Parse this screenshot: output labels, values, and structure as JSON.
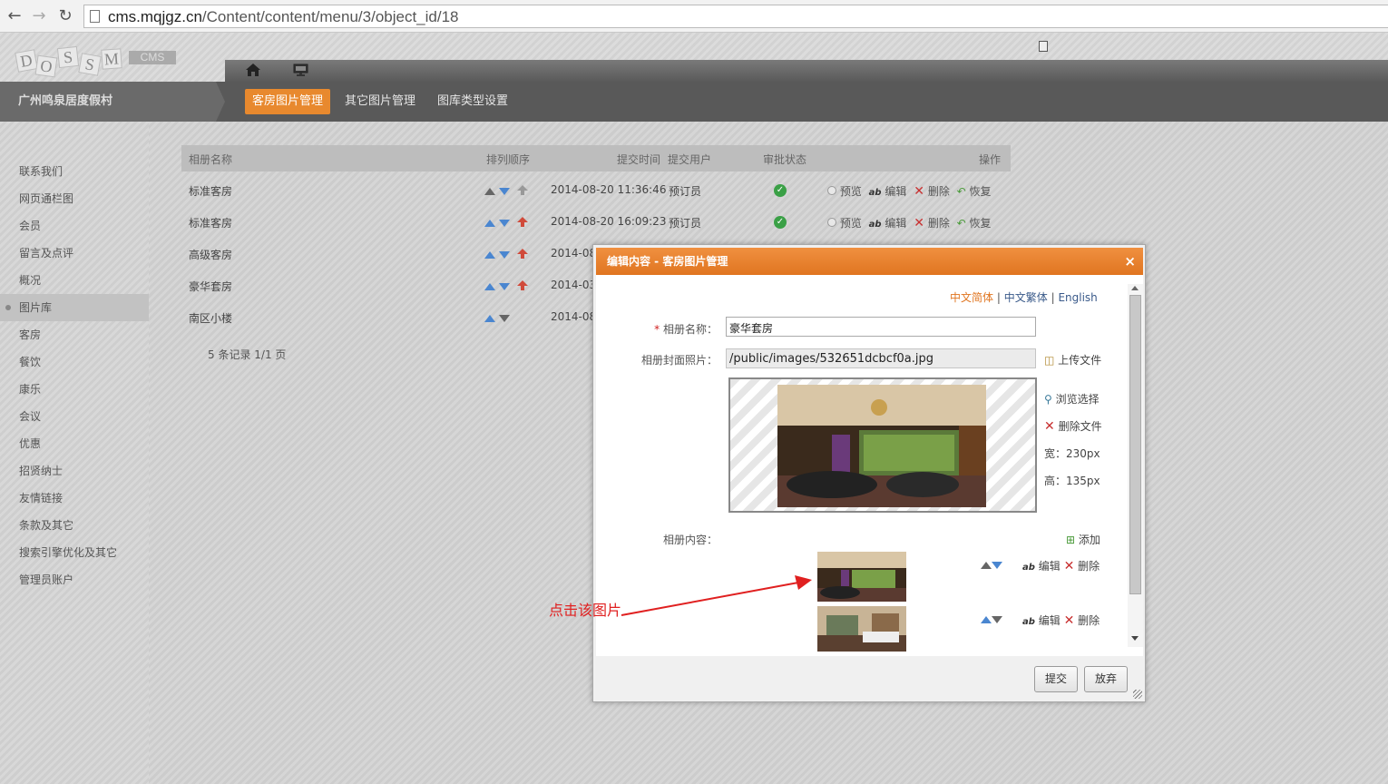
{
  "browser": {
    "url_domain": "cms.mqjgz.cn",
    "url_path": "/Content/content/menu/3/object_id/18"
  },
  "logo": {
    "letters": [
      "D",
      "O",
      "S",
      "S",
      "M"
    ],
    "badge": "CMS"
  },
  "site": {
    "name": "广州鸣泉居度假村"
  },
  "tabs": [
    {
      "label": "客房图片管理",
      "active": true
    },
    {
      "label": "其它图片管理",
      "active": false
    },
    {
      "label": "图库类型设置",
      "active": false
    }
  ],
  "sidebar": {
    "items": [
      {
        "label": "联系我们"
      },
      {
        "label": "网页通栏图"
      },
      {
        "label": "会员"
      },
      {
        "label": "留言及点评"
      },
      {
        "label": "概况"
      },
      {
        "label": "图片库",
        "active": true
      },
      {
        "label": "客房"
      },
      {
        "label": "餐饮"
      },
      {
        "label": "康乐"
      },
      {
        "label": "会议"
      },
      {
        "label": "优惠"
      },
      {
        "label": "招贤纳士"
      },
      {
        "label": "友情链接"
      },
      {
        "label": "条款及其它"
      },
      {
        "label": "搜索引擎优化及其它"
      },
      {
        "label": "管理员账户"
      }
    ]
  },
  "table": {
    "headers": {
      "name": "相册名称",
      "order": "排列顺序",
      "time": "提交时间",
      "user": "提交用户",
      "status": "审批状态",
      "ops": "操作"
    },
    "rows": [
      {
        "name": "标准客房",
        "time": "2014-08-20 11:36:46",
        "user": "预订员"
      },
      {
        "name": "标准客房",
        "time": "2014-08-20 16:09:23",
        "user": "预订员"
      },
      {
        "name": "高级客房",
        "time": "2014-08"
      },
      {
        "name": "豪华套房",
        "time": "2014-03"
      },
      {
        "name": "南区小楼",
        "time": "2014-08"
      }
    ],
    "ops": {
      "preview": "预览",
      "edit": "编辑",
      "delete": "删除",
      "restore": "恢复"
    },
    "records": "5 条记录 1/1 页"
  },
  "modal": {
    "title": "编辑内容 - 客房图片管理",
    "close": "×",
    "langs": {
      "simplified": "中文简体",
      "traditional": "中文繁体",
      "english": "English",
      "sep": "|"
    },
    "album_name_label": "相册名称：",
    "album_name_value": "豪华套房",
    "cover_label": "相册封面照片：",
    "cover_value": "/public/images/532651dcbcf0a.jpg",
    "upload": "上传文件",
    "browse": "浏览选择",
    "delete_file": "删除文件",
    "width_text": "宽：230px",
    "height_text": "高：135px",
    "content_label": "相册内容：",
    "add": "添加",
    "item_edit": "编辑",
    "item_delete": "删除",
    "submit": "提交",
    "cancel": "放弃"
  },
  "annotation": {
    "text": "点击该图片",
    "color": "#e02020"
  },
  "colors": {
    "accent": "#e8892e",
    "header_dark": "#595959"
  }
}
